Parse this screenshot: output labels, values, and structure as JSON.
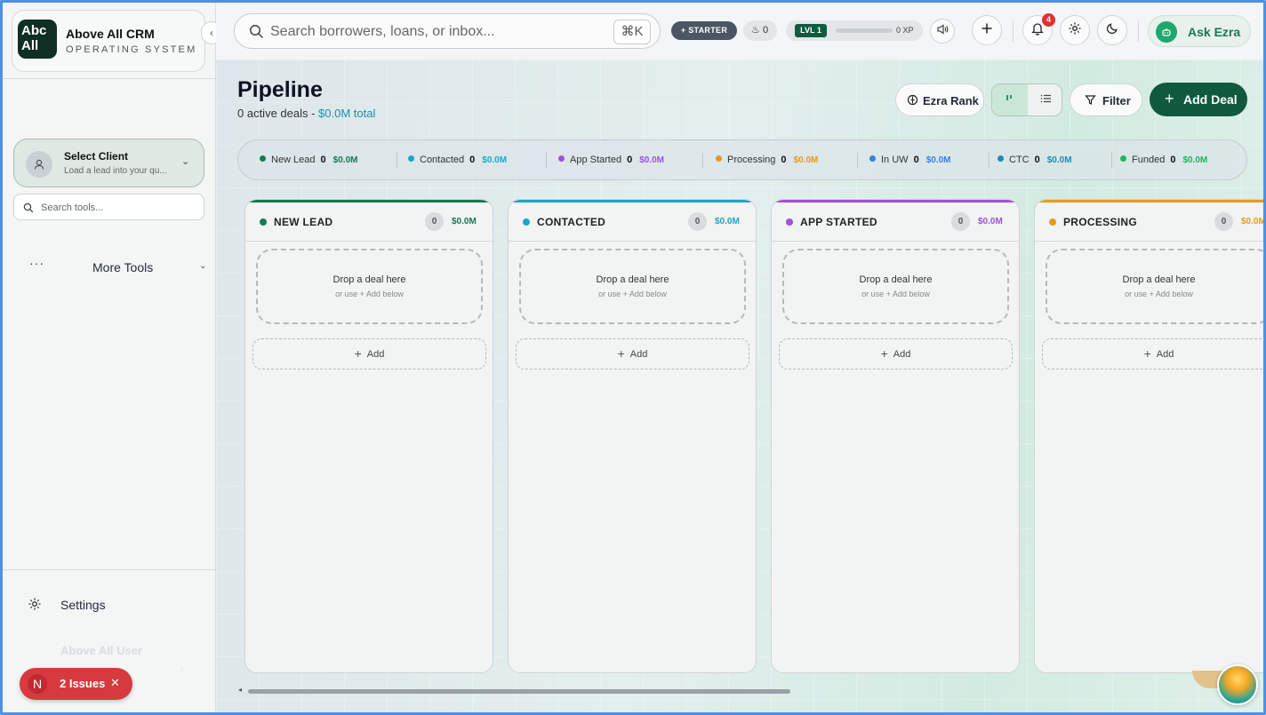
{
  "brand": {
    "logo_text": "Abc\nAll",
    "title": "Above All CRM",
    "subtitle": "OPERATING SYSTEM",
    "collapse_icon": "chevron-left-icon"
  },
  "sidebar": {
    "select_client": {
      "title": "Select Client",
      "subtitle": "Load a lead into your qu..."
    },
    "tool_search_placeholder": "Search tools...",
    "more_tools_label": "More Tools",
    "settings_label": "Settings",
    "user_name": "Above All User",
    "issues": {
      "avatar_letter": "N",
      "label": "2 Issues"
    }
  },
  "header": {
    "search_placeholder": "Search borrowers, loans, or inbox...",
    "shortcut": "⌘K",
    "plan_badge": "+ STARTER",
    "streak_count": "0",
    "level_label": "LVL 1",
    "xp_text": "0 XP",
    "xp_progress": 0,
    "notifications_count": "4",
    "ask_ezra_label": "Ask Ezra"
  },
  "page": {
    "title": "Pipeline",
    "summary_prefix": "0 active deals - ",
    "summary_total": "$0.0M total",
    "ezra_rank_label": "Ezra Rank",
    "filter_label": "Filter",
    "add_deal_label": "Add Deal"
  },
  "stages": [
    {
      "name": "New Lead",
      "count": "0",
      "amount": "$0.0M",
      "color": "#167a52"
    },
    {
      "name": "Contacted",
      "count": "0",
      "amount": "$0.0M",
      "color": "#19a8c8"
    },
    {
      "name": "App Started",
      "count": "0",
      "amount": "$0.0M",
      "color": "#a052d8"
    },
    {
      "name": "Processing",
      "count": "0",
      "amount": "$0.0M",
      "color": "#e8991c"
    },
    {
      "name": "In UW",
      "count": "0",
      "amount": "$0.0M",
      "color": "#3b7fdc"
    },
    {
      "name": "CTC",
      "count": "0",
      "amount": "$0.0M",
      "color": "#1a8fb5"
    },
    {
      "name": "Funded",
      "count": "0",
      "amount": "$0.0M",
      "color": "#22b35f"
    }
  ],
  "columns": [
    {
      "title": "NEW LEAD",
      "count": "0",
      "amount": "$0.0M",
      "color": "#167a52",
      "drop_text": "Drop a deal here",
      "drop_hint": "or use + Add below",
      "add_label": "Add"
    },
    {
      "title": "CONTACTED",
      "count": "0",
      "amount": "$0.0M",
      "color": "#19a8c8",
      "drop_text": "Drop a deal here",
      "drop_hint": "or use + Add below",
      "add_label": "Add"
    },
    {
      "title": "APP STARTED",
      "count": "0",
      "amount": "$0.0M",
      "color": "#a052d8",
      "drop_text": "Drop a deal here",
      "drop_hint": "or use + Add below",
      "add_label": "Add"
    },
    {
      "title": "PROCESSING",
      "count": "0",
      "amount": "$0.0M",
      "color": "#e8991c",
      "drop_text": "Drop a deal here",
      "drop_hint": "or use + Add below",
      "add_label": "Add"
    }
  ]
}
